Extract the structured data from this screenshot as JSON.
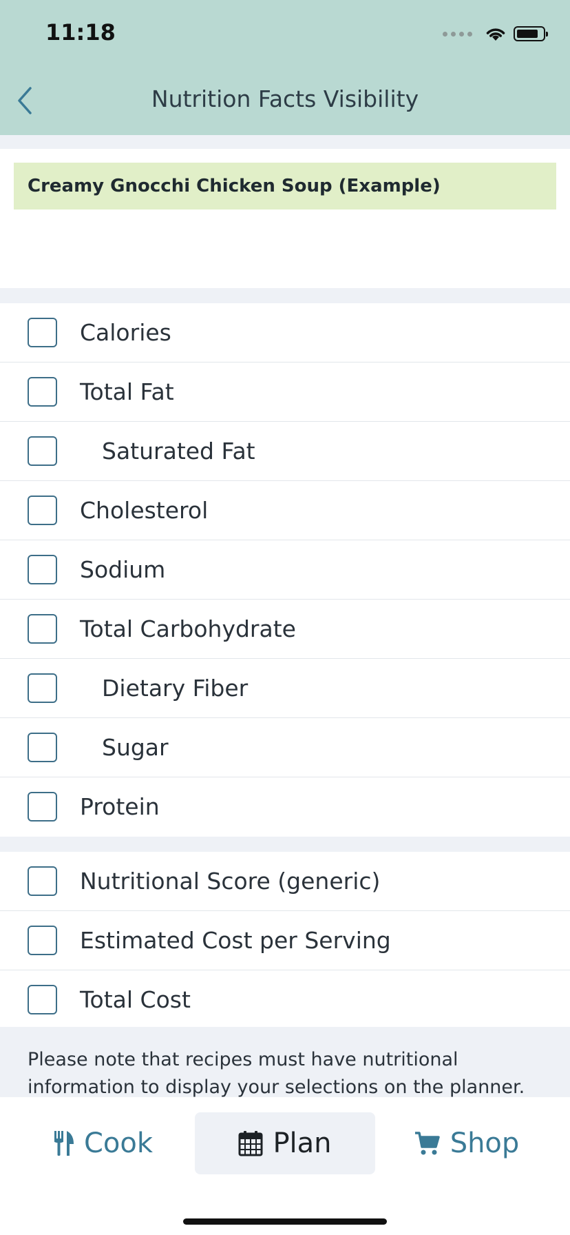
{
  "status_bar": {
    "time": "11:18"
  },
  "header": {
    "title": "Nutrition Facts Visibility"
  },
  "recipe": {
    "name": "Creamy Gnocchi Chicken Soup (Example)"
  },
  "nutrition_items": [
    {
      "label": "Calories",
      "checked": false
    },
    {
      "label": "Total Fat",
      "checked": false
    },
    {
      "label": "Saturated Fat",
      "checked": false
    },
    {
      "label": "Cholesterol",
      "checked": false
    },
    {
      "label": "Sodium",
      "checked": false
    },
    {
      "label": "Total Carbohydrate",
      "checked": false
    },
    {
      "label": "Dietary Fiber",
      "checked": false
    },
    {
      "label": "Sugar",
      "checked": false
    },
    {
      "label": "Protein",
      "checked": false
    }
  ],
  "extra_items": [
    {
      "label": "Nutritional Score (generic)",
      "checked": false
    },
    {
      "label": "Estimated Cost per Serving",
      "checked": false
    },
    {
      "label": "Total Cost",
      "checked": false
    }
  ],
  "note": {
    "text": "Please note that recipes must have nutritional information to display your selections on the planner."
  },
  "tabs": {
    "cook": {
      "label": "Cook",
      "icon": "utensils-icon"
    },
    "plan": {
      "label": "Plan",
      "icon": "calendar-icon",
      "active": true
    },
    "shop": {
      "label": "Shop",
      "icon": "cart-icon"
    }
  },
  "colors": {
    "header_bg": "#b9d9d2",
    "accent": "#3a7a96",
    "recipe_banner_bg": "#e1efc8",
    "section_bg": "#eef1f6"
  }
}
